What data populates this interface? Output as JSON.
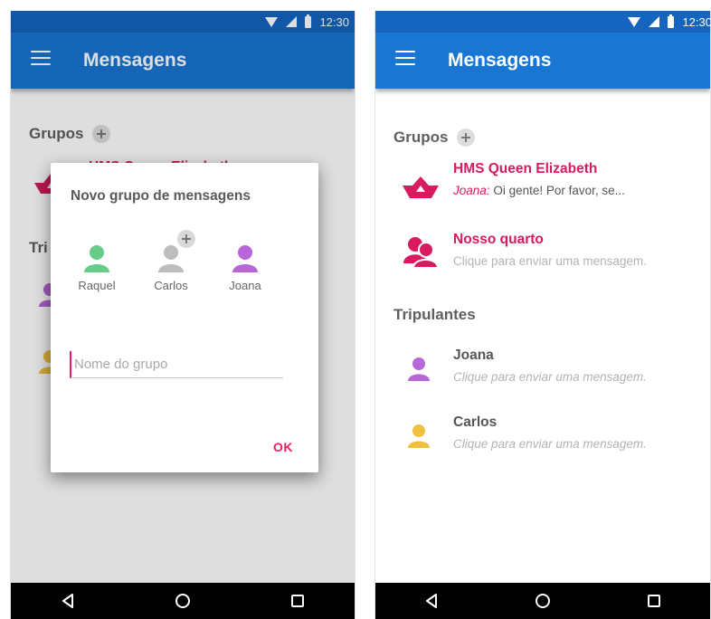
{
  "colors": {
    "app_bar": "#1976d2",
    "status_bar": "#1565c0",
    "accent": "#d81b60",
    "ok": "#e91e63"
  },
  "left_screen": {
    "status": {
      "time": "12:30"
    },
    "app_bar": {
      "title": "Mensagens",
      "menu_icon": "hamburger-menu-icon"
    },
    "groups_header": "Grupos",
    "first_group_title": "HMS Queen Elizabeth",
    "crew_header_partial": "Tri",
    "dialog": {
      "title": "Novo grupo de mensagens",
      "members": [
        {
          "name": "Raquel",
          "color": "#66cc88"
        },
        {
          "name": "Carlos",
          "color": "#bdbdbd"
        },
        {
          "name": "Joana",
          "color": "#b866d8"
        }
      ],
      "group_name_placeholder": "Nome do grupo",
      "ok_label": "OK"
    }
  },
  "right_screen": {
    "status": {
      "time": "12:30"
    },
    "app_bar": {
      "title": "Mensagens",
      "menu_icon": "hamburger-menu-icon"
    },
    "groups_header": "Grupos",
    "groups": [
      {
        "title": "HMS Queen Elizabeth",
        "sender": "Joana:",
        "preview": "Oi gente! Por favor, se...",
        "icon": "paper-boat-icon"
      },
      {
        "title": "Nosso quarto",
        "hint": "Clique para enviar uma mensagem.",
        "icon": "group-people-icon"
      }
    ],
    "crew_header": "Tripulantes",
    "crew": [
      {
        "name": "Joana",
        "hint": "Clique para enviar uma mensagem.",
        "color": "#b866d8"
      },
      {
        "name": "Carlos",
        "hint": "Clique para enviar uma mensagem.",
        "color": "#f0c040"
      }
    ]
  }
}
